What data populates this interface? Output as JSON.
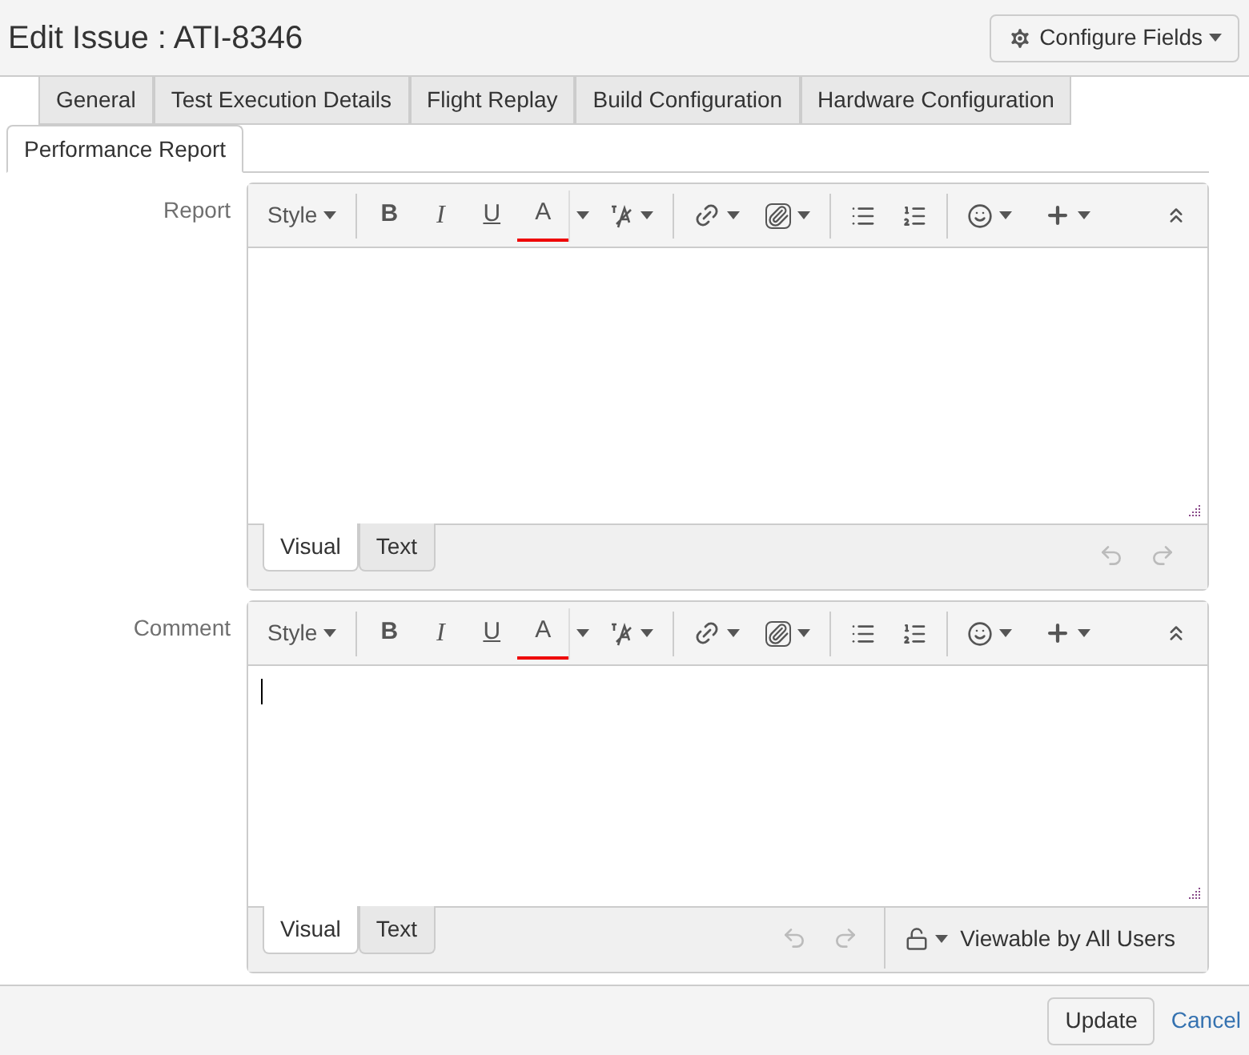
{
  "header": {
    "title": "Edit Issue : ATI-8346",
    "configure_button": "Configure Fields"
  },
  "tabs": [
    {
      "label": "General",
      "selected": false
    },
    {
      "label": "Test Execution Details",
      "selected": false
    },
    {
      "label": "Flight Replay",
      "selected": false
    },
    {
      "label": "Build Configuration",
      "selected": false
    },
    {
      "label": "Hardware Configuration",
      "selected": false
    },
    {
      "label": "Performance Report",
      "selected": true
    }
  ],
  "editors": [
    {
      "label": "Report",
      "toolbar": {
        "style": "Style",
        "bold": "B",
        "italic": "I",
        "underline": "U",
        "font_color": "A"
      },
      "focused": false,
      "mode_tabs": [
        {
          "label": "Visual",
          "selected": true
        },
        {
          "label": "Text",
          "selected": false
        }
      ]
    },
    {
      "label": "Comment",
      "toolbar": {
        "style": "Style",
        "bold": "B",
        "italic": "I",
        "underline": "U",
        "font_color": "A"
      },
      "focused": true,
      "mode_tabs": [
        {
          "label": "Visual",
          "selected": true
        },
        {
          "label": "Text",
          "selected": false
        }
      ],
      "visibility": "Viewable by All Users"
    }
  ],
  "footer": {
    "update_button": "Update",
    "cancel_link": "Cancel"
  }
}
